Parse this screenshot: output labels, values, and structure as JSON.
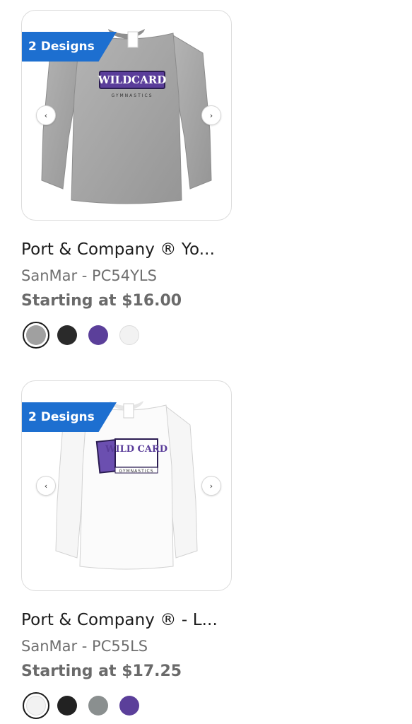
{
  "products": [
    {
      "badge": "2 Designs",
      "title": "Port & Company ® Yo...",
      "sku": "SanMar - PC54YLS",
      "price": "Starting at $16.00",
      "shirt_color": "#a6a6a6",
      "logo_text": "WILDCARD",
      "logo_sub": "GYMNASTICS",
      "swatches": [
        {
          "color": "#a0a0a0",
          "selected": true
        },
        {
          "color": "#2a2a2a",
          "selected": false
        },
        {
          "color": "#5b3f9a",
          "selected": false
        },
        {
          "color": "#f2f2f2",
          "selected": false
        }
      ]
    },
    {
      "badge": "2 Designs",
      "title": "Port & Company ® - L...",
      "sku": "SanMar - PC55LS",
      "price": "Starting at $17.25",
      "shirt_color": "#f7f7f7",
      "logo_text": "WILD CARD",
      "logo_sub": "GYMNASTICS",
      "swatches": [
        {
          "color": "#f2f2f2",
          "selected": true
        },
        {
          "color": "#222222",
          "selected": false
        },
        {
          "color": "#8a8f8f",
          "selected": false
        },
        {
          "color": "#5b3f9a",
          "selected": false
        }
      ]
    }
  ],
  "icons": {
    "prev": "‹",
    "next": "›"
  }
}
